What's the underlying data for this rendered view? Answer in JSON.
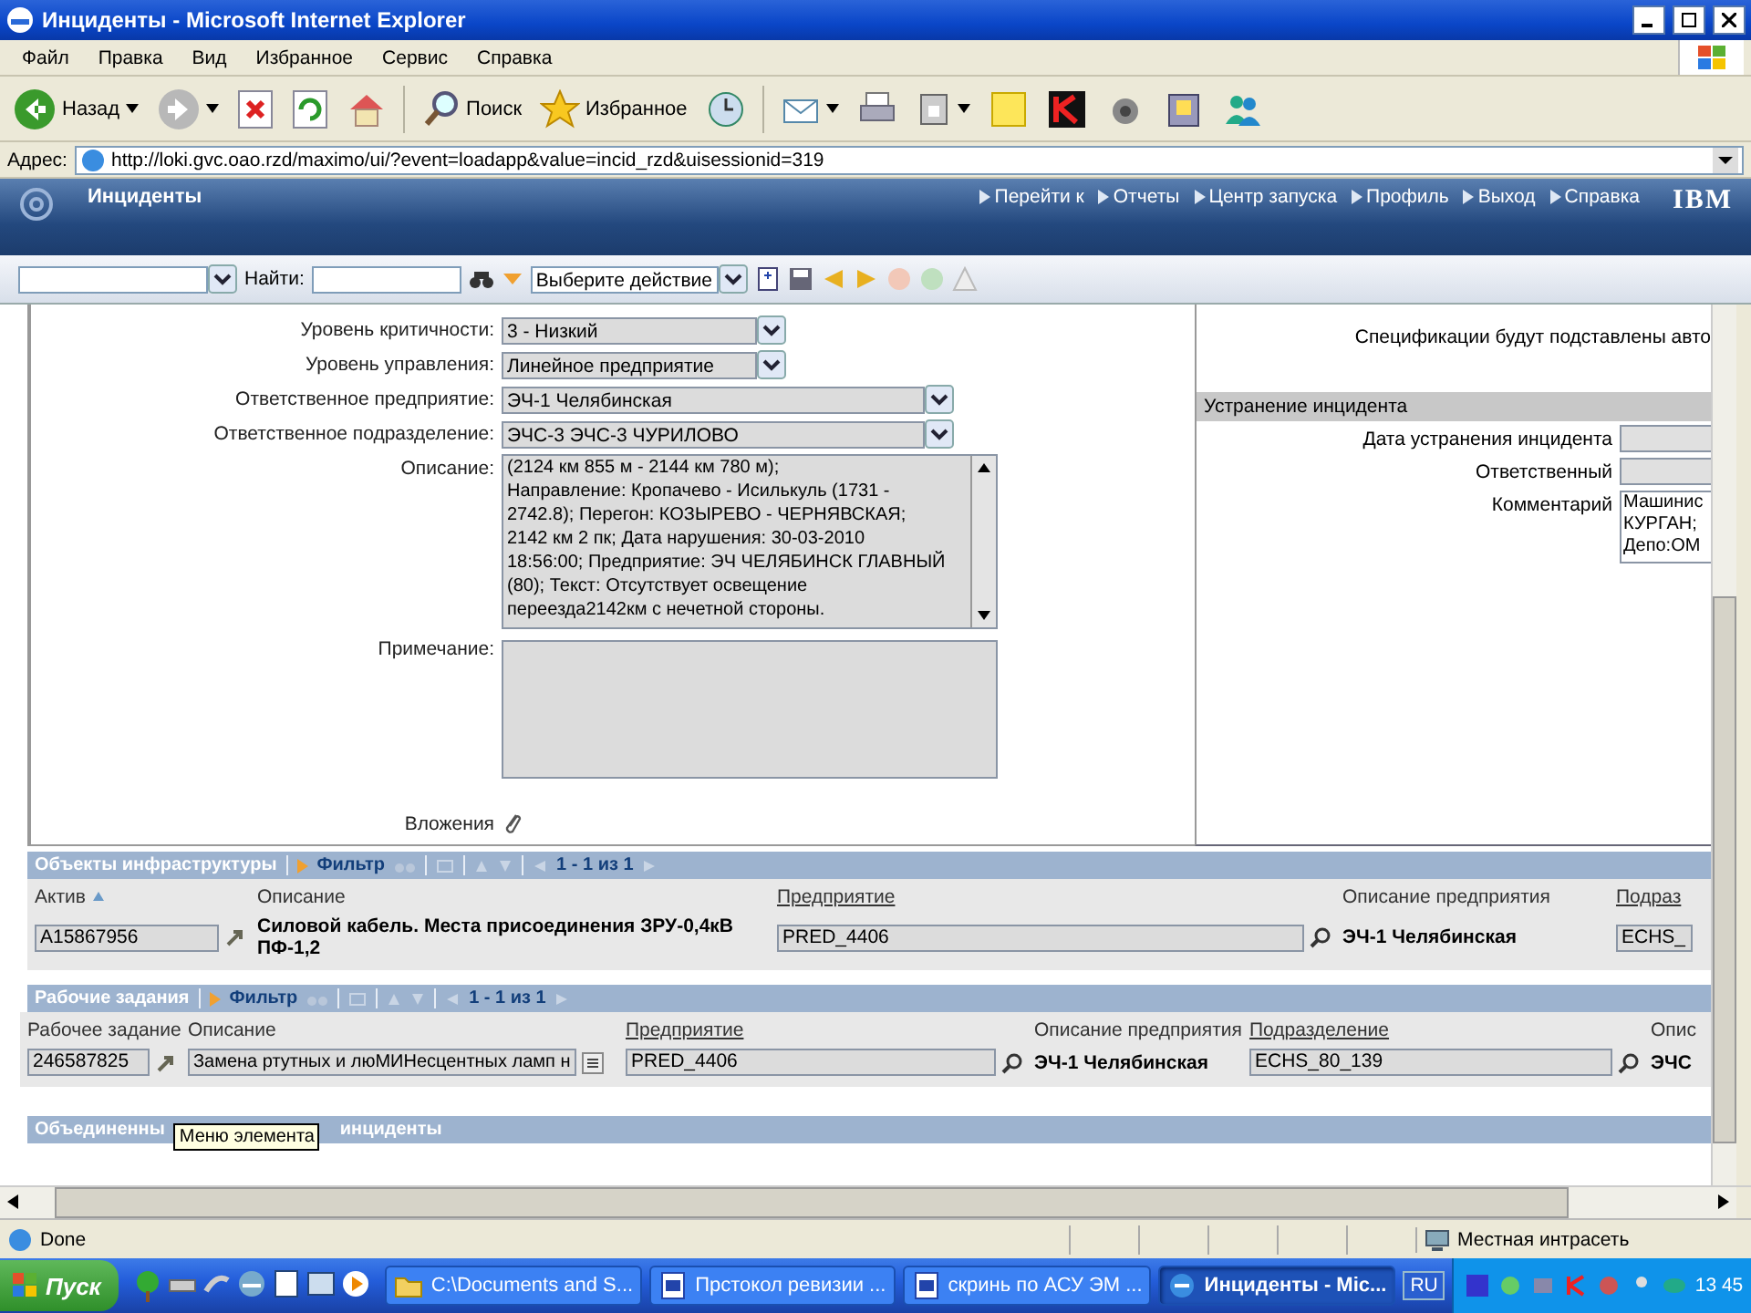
{
  "window": {
    "title": "Инциденты - Microsoft Internet Explorer"
  },
  "menu": [
    "Файл",
    "Правка",
    "Вид",
    "Избранное",
    "Сервис",
    "Справка"
  ],
  "toolbar": [
    {
      "kind": "back",
      "label": "Назад",
      "dropdown": true
    },
    {
      "kind": "forward",
      "dropdown": true
    },
    {
      "kind": "stop"
    },
    {
      "kind": "refresh"
    },
    {
      "kind": "home"
    },
    {
      "kind": "search",
      "label": "Поиск"
    },
    {
      "kind": "favorites",
      "label": "Избранное"
    },
    {
      "kind": "history"
    },
    {
      "kind": "mail",
      "dropdown": true
    },
    {
      "kind": "print"
    },
    {
      "kind": "edit",
      "dropdown": true
    },
    {
      "kind": "note"
    },
    {
      "kind": "antivirus"
    },
    {
      "kind": "tool"
    },
    {
      "kind": "media"
    },
    {
      "kind": "messenger"
    }
  ],
  "address": {
    "label": "Адрес:",
    "url": "http://loki.gvc.oao.rzd/maximo/ui/?event=loadapp&value=incid_rzd&uisessionid=319"
  },
  "app_header": {
    "title": "Инциденты",
    "links": [
      "Перейти к",
      "Отчеты",
      "Центр запуска",
      "Профиль",
      "Выход",
      "Справка"
    ],
    "logo": "IBM"
  },
  "app_toolbar": {
    "find_label": "Найти:",
    "action": "Выберите действие"
  },
  "form": {
    "fields": [
      {
        "kind": "select",
        "label": "Уровень критичности:",
        "value": "3 - Низкий"
      },
      {
        "kind": "select",
        "label": "Уровень управления:",
        "value": "Линейное предприятие"
      },
      {
        "kind": "lookup",
        "label": "Ответственное предприятие:",
        "value": "ЭЧ-1 Челябинская"
      },
      {
        "kind": "lookup",
        "label": "Ответственное подразделение:",
        "value": "ЭЧС-3 ЭЧС-3 ЧУРИЛОВО"
      },
      {
        "kind": "textarea",
        "label": "Описание:",
        "lines": [
          "(2124 км 855 м - 2144 км 780 м);",
          "Направление: Кропачево - Исилькуль (1731 -",
          "2742.8); Перегон: КОЗЫРЕВО - ЧЕРНЯВСКАЯ;",
          "2142 км 2 пк; Дата нарушения: 30-03-2010",
          "18:56:00; Предприятие: ЭЧ ЧЕЛЯБИНСК ГЛАВНЫЙ",
          "(80); Текст: Отсутствует освещение",
          "переезда2142км с нечетной стороны."
        ]
      },
      {
        "kind": "note",
        "label": "Примечание:"
      },
      {
        "kind": "attachments",
        "label": "Вложения"
      }
    ]
  },
  "right_panel": {
    "notice": "Спецификации будут подставлены авто",
    "section": "Устранение инцидента",
    "fields": [
      {
        "kind": "field",
        "label": "Дата устранения инцидента"
      },
      {
        "kind": "field",
        "label": "Ответственный"
      },
      {
        "kind": "textarea",
        "label": "Комментарий",
        "lines": [
          "Машинис",
          "КУРГАН;",
          "Депо:ОМ"
        ]
      }
    ]
  },
  "tables": [
    {
      "title": "Объекты инфраструктуры",
      "filter": "Фильтр",
      "pager": "1 - 1 из 1",
      "columns": [
        {
          "label": "Актив",
          "sorted": true,
          "link": false
        },
        {
          "label": "Описание",
          "sorted": false,
          "link": false
        },
        {
          "label": "Предприятие",
          "sorted": false,
          "link": true
        },
        {
          "label": "Описание предприятия",
          "sorted": false,
          "link": false
        },
        {
          "label": "Подраз",
          "sorted": false,
          "link": true
        }
      ],
      "row": [
        {
          "kind": "field",
          "value": "A15867956"
        },
        {
          "kind": "bold",
          "value": "Силовой кабель. Места присоединения ЗРУ-0,4кВ ПФ-1,2"
        },
        {
          "kind": "field",
          "value": "PRED_4406"
        },
        {
          "kind": "bold",
          "value": "ЭЧ-1 Челябинская"
        },
        {
          "kind": "field",
          "value": "ECHS_"
        }
      ]
    },
    {
      "title": "Рабочие задания",
      "filter": "Фильтр",
      "pager": "1 - 1 из 1",
      "columns": [
        {
          "label": "Рабочее задание",
          "sorted": false,
          "link": false
        },
        {
          "label": "Описание",
          "sorted": false,
          "link": false
        },
        {
          "label": "Предприятие",
          "sorted": false,
          "link": true
        },
        {
          "label": "Описание предприятия",
          "sorted": false,
          "link": false
        },
        {
          "label": "Подразделение",
          "sorted": false,
          "link": true
        },
        {
          "label": "Опис",
          "sorted": false,
          "link": false
        }
      ],
      "row": [
        {
          "kind": "field",
          "value": "246587825"
        },
        {
          "kind": "field",
          "value": "Замена ртутных и люМИНесцентных ламп н"
        },
        {
          "kind": "field",
          "value": "PRED_4406"
        },
        {
          "kind": "bold",
          "value": "ЭЧ-1 Челябинская"
        },
        {
          "kind": "field",
          "value": "ECHS_80_139"
        },
        {
          "kind": "bold",
          "value": "ЭЧС"
        }
      ]
    }
  ],
  "merged_section": {
    "title_start": "Объединенны",
    "title_end": "инциденты"
  },
  "tooltip": "Меню элемента",
  "status_bar": {
    "text": "Done",
    "zone": "Местная интрасеть"
  },
  "taskbar": {
    "start": "Пуск",
    "tasks": [
      {
        "kind": "folder",
        "label": "C:\\Documents and S...",
        "selected": false
      },
      {
        "kind": "word",
        "label": "Прстокол ревизии ...",
        "selected": false
      },
      {
        "kind": "word",
        "label": "скринь по АСУ ЭМ ...",
        "selected": false
      },
      {
        "kind": "ie",
        "label": "Инциденты - Mic...",
        "selected": true
      }
    ],
    "language": "RU",
    "clock": "13 45"
  }
}
